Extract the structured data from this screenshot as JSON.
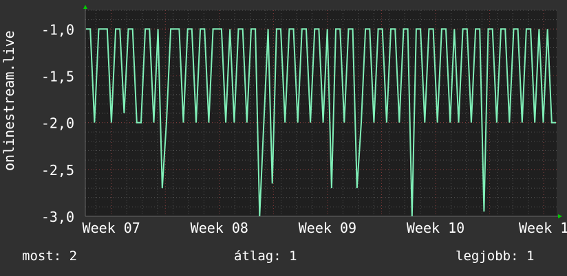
{
  "chart_data": {
    "type": "line",
    "title": "",
    "ylabel": "onlinestream.live",
    "xlabel": "",
    "ylim": [
      -3.0,
      -0.8
    ],
    "xlim_weeks": [
      6.76,
      11.12
    ],
    "yticks": [
      -1.0,
      -1.5,
      -2.0,
      -2.5,
      -3.0
    ],
    "ytick_labels": [
      "-1,0",
      "-1,5",
      "-2,0",
      "-2,5",
      "-3,0"
    ],
    "xticks": [
      7,
      8,
      9,
      10,
      11
    ],
    "xtick_labels": [
      "Week 07",
      "Week 08",
      "Week 09",
      "Week 10",
      "Week 1"
    ],
    "grid": true,
    "line_color": "#80f0b8",
    "series": [
      {
        "values": [
          -1,
          -1,
          -2,
          -1,
          -1,
          -1,
          -2,
          -1,
          -1,
          -1.9,
          -1,
          -1,
          -2,
          -2,
          -1,
          -1,
          -2,
          -1,
          -2.7,
          -2,
          -1,
          -1,
          -1,
          -2,
          -1,
          -1,
          -2,
          -1,
          -1,
          -2,
          -1,
          -1,
          -1,
          -2,
          -1,
          -2,
          -1,
          -1,
          -2,
          -1,
          -1,
          -3,
          -2,
          -1,
          -2.65,
          -1,
          -1,
          -2,
          -1,
          -1,
          -2,
          -1,
          -1,
          -2,
          -1,
          -1,
          -2,
          -1,
          -2.7,
          -1,
          -1,
          -2,
          -1,
          -1,
          -2.7,
          -2,
          -1,
          -1,
          -2,
          -1,
          -1,
          -2,
          -1,
          -1,
          -2,
          -1,
          -1,
          -3,
          -1,
          -1,
          -2,
          -1,
          -1,
          -2,
          -1,
          -1,
          -2,
          -1,
          -2,
          -1,
          -1,
          -2,
          -1,
          -1,
          -2.95,
          -1,
          -1,
          -2,
          -1,
          -1,
          -2,
          -1,
          -1,
          -2,
          -1,
          -1,
          -2,
          -1,
          -2,
          -1,
          -2,
          -2
        ]
      }
    ]
  },
  "legend": {
    "current": "most: 2",
    "average": "átlag: 1",
    "max": "legjobb: 1"
  },
  "colors": {
    "background": "#303030",
    "plot_background": "#1f1f1f",
    "major_grid": "#8a3a3a",
    "minor_grid": "#555555",
    "axis_arrow": "#00cc00"
  }
}
